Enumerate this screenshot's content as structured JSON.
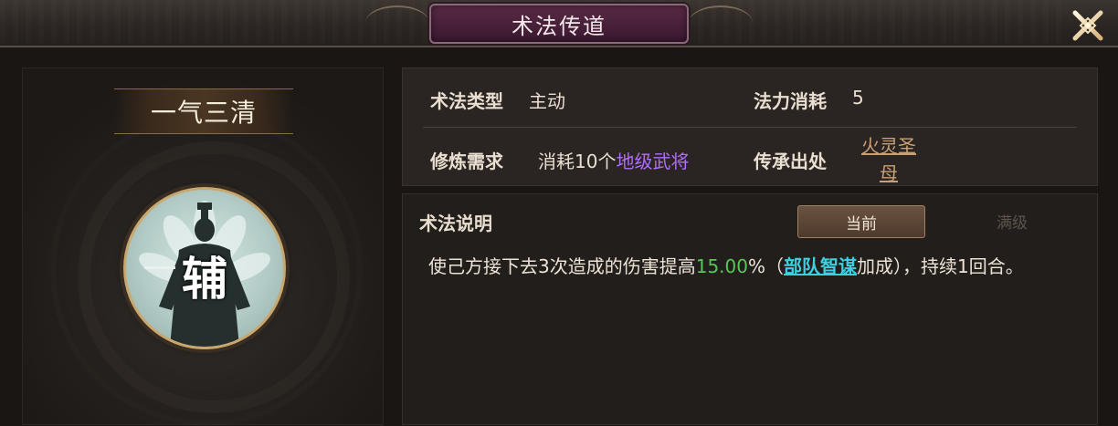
{
  "header": {
    "title": "术法传道"
  },
  "skill": {
    "name": "一气三清",
    "portrait_glyph": "辅"
  },
  "info": {
    "type_label": "术法类型",
    "type_value": "主动",
    "cost_label": "法力消耗",
    "cost_value": "5",
    "req_label": "修炼需求",
    "req_prefix": "消耗10个",
    "req_item": "地级武将",
    "source_label": "传承出处",
    "source_value_line1": "火灵圣",
    "source_value_line2": "母"
  },
  "description": {
    "title": "术法说明",
    "tab_current": "当前",
    "tab_max": "满级",
    "text_part1": "使己方接下去3次造成的伤害提高",
    "text_percent": "15.00",
    "text_part2": "%（",
    "text_link": "部队智谋",
    "text_part3": "加成），持续1回合。"
  },
  "colors": {
    "purple_item": "#b26cff",
    "green_value": "#58c45a",
    "cyan_link": "#3fd0e0",
    "source_link": "#c9a074"
  },
  "icons": {
    "close": "close-x-icon",
    "portrait": "sage-silhouette-icon"
  }
}
